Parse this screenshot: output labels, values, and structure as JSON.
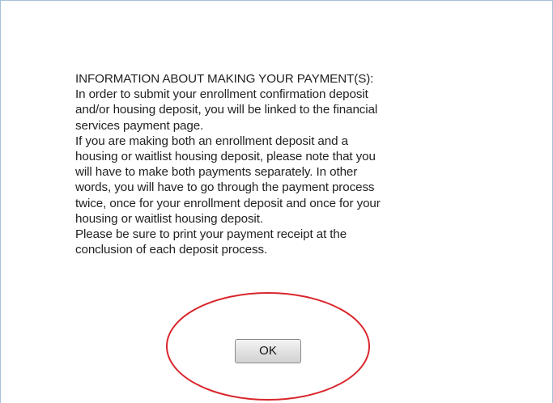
{
  "dialog": {
    "message_lines": [
      "INFORMATION ABOUT MAKING YOUR PAYMENT(S):",
      "In order to submit your enrollment confirmation deposit",
      "and/or housing deposit, you will be linked to the financial",
      "services payment page.",
      "If you are making both an enrollment deposit and a",
      "housing or waitlist housing deposit, please note that you",
      "will have to make both payments separately. In other",
      "words, you will have to go through the payment process",
      "twice, once for your enrollment deposit and once for your",
      "housing or waitlist housing deposit.",
      "Please be sure to print your payment receipt at the",
      "conclusion of each deposit process."
    ],
    "ok_label": "OK"
  },
  "colors": {
    "frame_border": "#a9bfd6",
    "annotation_circle": "#d9262c",
    "text": "#222222"
  }
}
